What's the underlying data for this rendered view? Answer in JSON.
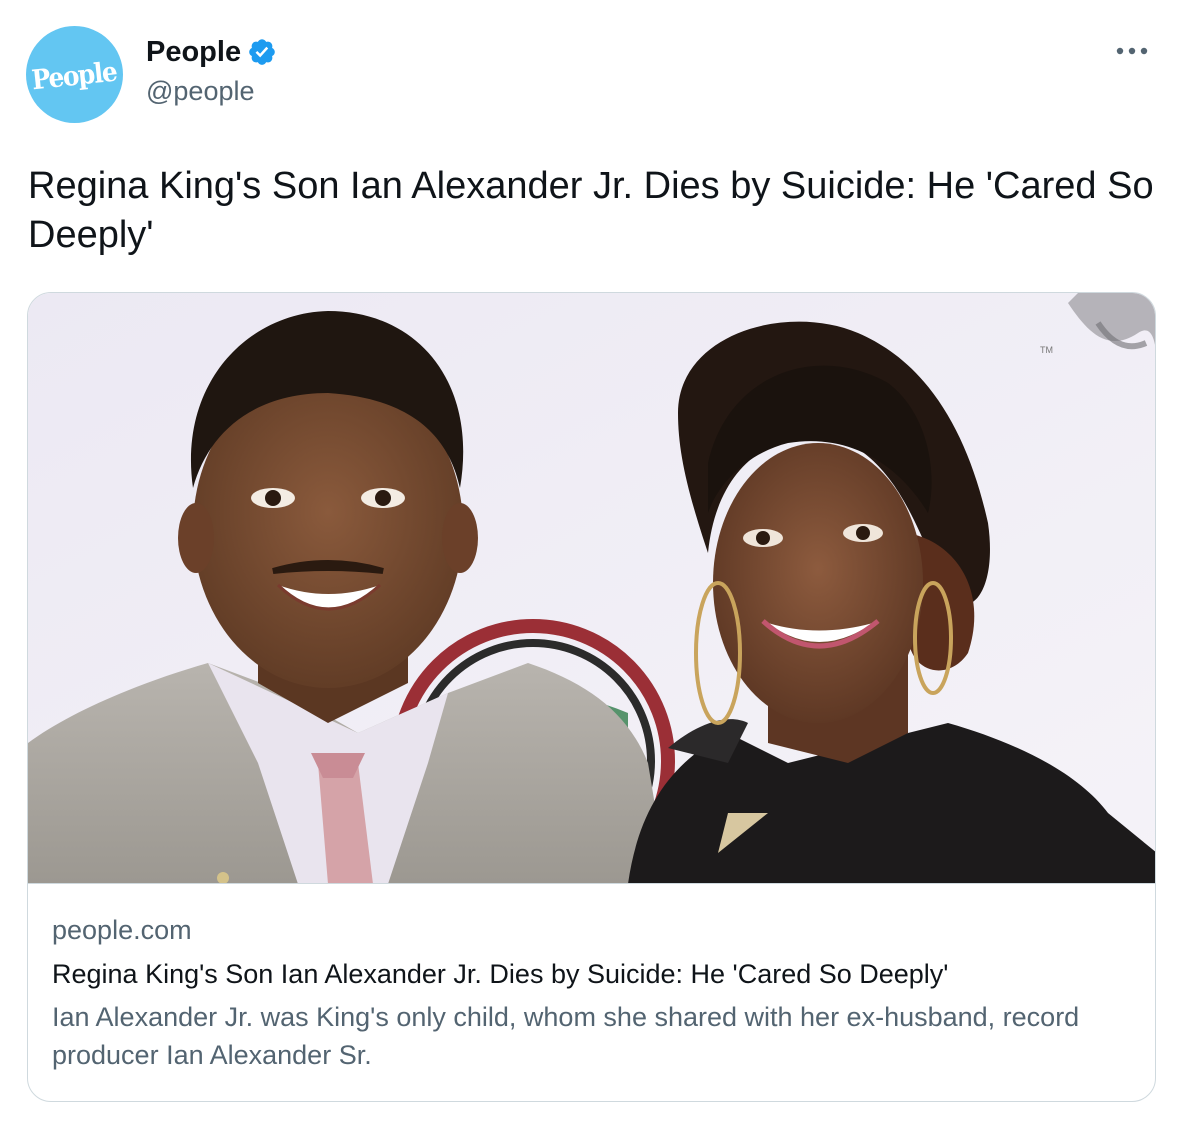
{
  "author": {
    "display_name": "People",
    "handle": "@people",
    "avatar_text": "People",
    "avatar_color": "#63c6f2",
    "verified": true,
    "verified_color": "#1d9bf0"
  },
  "menu_icon": "more-horizontal-icon",
  "tweet": {
    "text": "Regina King's Son Ian Alexander Jr. Dies by Suicide: He 'Cared So Deeply'"
  },
  "card": {
    "domain": "people.com",
    "title": "Regina King's Son Ian Alexander Jr. Dies by Suicide: He 'Cared So Deeply'",
    "description": "Ian Alexander Jr. was King's only child, whom she shared with her ex-husband, record producer Ian Alexander Sr.",
    "image_watermark": "TM"
  },
  "colors": {
    "text_primary": "#0f1419",
    "text_secondary": "#536471",
    "border": "#cfd9de"
  }
}
